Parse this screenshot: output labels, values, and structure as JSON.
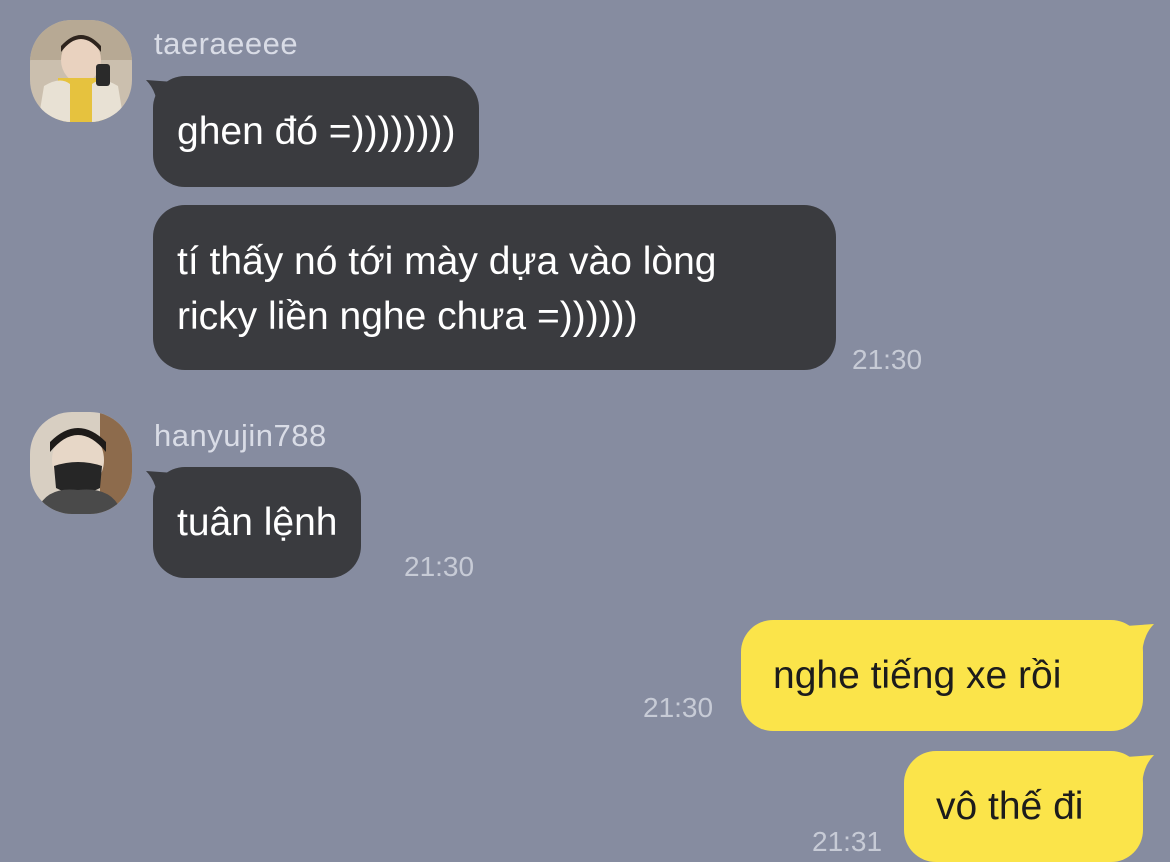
{
  "chat": {
    "colors": {
      "background": "#868ca0",
      "incoming_bubble": "#3a3b3f",
      "outgoing_bubble": "#fbe44a"
    },
    "group1": {
      "username": "taeraeeee",
      "avatar_icon": "user-avatar-photo",
      "msg1": "ghen đó =))))))))",
      "msg2_line1": "tí thấy nó tới mày dựa vào lòng",
      "msg2_line2": "ricky liền nghe chưa =))))))",
      "time": "21:30"
    },
    "group2": {
      "username": "hanyujin788",
      "avatar_icon": "user-avatar-photo",
      "msg1": "tuân lệnh",
      "time": "21:30"
    },
    "outgoing": {
      "msg1": "nghe tiếng xe rồi",
      "time1": "21:30",
      "msg2": "vô thế đi",
      "time2": "21:31"
    }
  }
}
